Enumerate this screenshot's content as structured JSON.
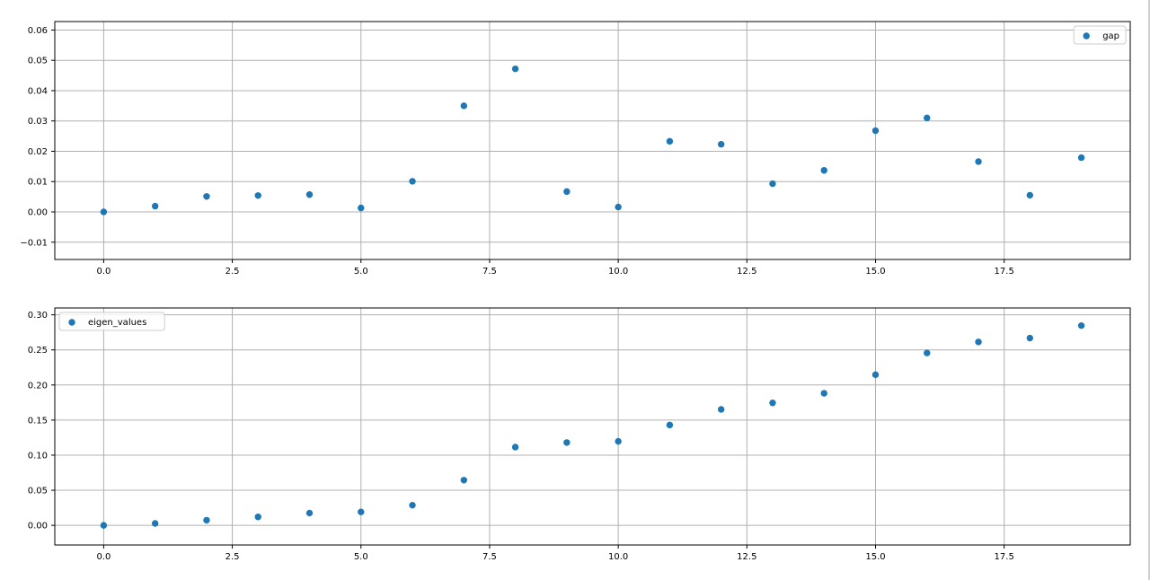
{
  "colors": {
    "point": "#1f77b4",
    "grid": "#b0b0b0",
    "axes": "#000000"
  },
  "chart_data": [
    {
      "type": "scatter",
      "title": "",
      "xlabel": "",
      "ylabel": "",
      "xlim": [
        -0.95,
        19.95
      ],
      "ylim": [
        -0.0157,
        0.0628
      ],
      "x_ticks": [
        0,
        2.5,
        5,
        7.5,
        10,
        12.5,
        15,
        17.5
      ],
      "x_tick_labels": [
        "0.0",
        "2.5",
        "5.0",
        "7.5",
        "10.0",
        "12.5",
        "15.0",
        "17.5"
      ],
      "y_ticks": [
        -0.01,
        0,
        0.01,
        0.02,
        0.03,
        0.04,
        0.05,
        0.06
      ],
      "y_tick_labels": [
        "−0.01",
        "0.00",
        "0.01",
        "0.02",
        "0.03",
        "0.04",
        "0.05",
        "0.06"
      ],
      "grid": true,
      "legend_position": "top-right",
      "series": [
        {
          "name": "gap",
          "x": [
            0,
            1,
            2,
            3,
            4,
            5,
            6,
            7,
            8,
            9,
            10,
            11,
            12,
            13,
            14,
            15,
            16,
            17,
            18,
            19
          ],
          "y": [
            0.0,
            0.0019,
            0.0051,
            0.0054,
            0.0057,
            0.0013,
            0.0101,
            0.035,
            0.0472,
            0.0067,
            0.0016,
            0.0233,
            0.0223,
            0.0093,
            0.0137,
            0.0268,
            0.031,
            0.0166,
            0.0055,
            0.0179
          ]
        }
      ]
    },
    {
      "type": "scatter",
      "title": "",
      "xlabel": "",
      "ylabel": "",
      "xlim": [
        -0.95,
        19.95
      ],
      "ylim": [
        -0.028,
        0.3098
      ],
      "x_ticks": [
        0,
        2.5,
        5,
        7.5,
        10,
        12.5,
        15,
        17.5
      ],
      "x_tick_labels": [
        "0.0",
        "2.5",
        "5.0",
        "7.5",
        "10.0",
        "12.5",
        "15.0",
        "17.5"
      ],
      "y_ticks": [
        0,
        0.05,
        0.1,
        0.15,
        0.2,
        0.25,
        0.3
      ],
      "y_tick_labels": [
        "0.00",
        "0.05",
        "0.10",
        "0.15",
        "0.20",
        "0.25",
        "0.30"
      ],
      "grid": true,
      "legend_position": "top-left",
      "series": [
        {
          "name": "eigen_values",
          "x": [
            0,
            1,
            2,
            3,
            4,
            5,
            6,
            7,
            8,
            9,
            10,
            11,
            12,
            13,
            14,
            15,
            16,
            17,
            18,
            19
          ],
          "y": [
            0.0,
            0.0027,
            0.0073,
            0.012,
            0.0175,
            0.0191,
            0.0287,
            0.0644,
            0.1115,
            0.118,
            0.1197,
            0.143,
            0.1652,
            0.1745,
            0.1882,
            0.2147,
            0.2457,
            0.2614,
            0.2669,
            0.2846
          ]
        }
      ]
    }
  ]
}
